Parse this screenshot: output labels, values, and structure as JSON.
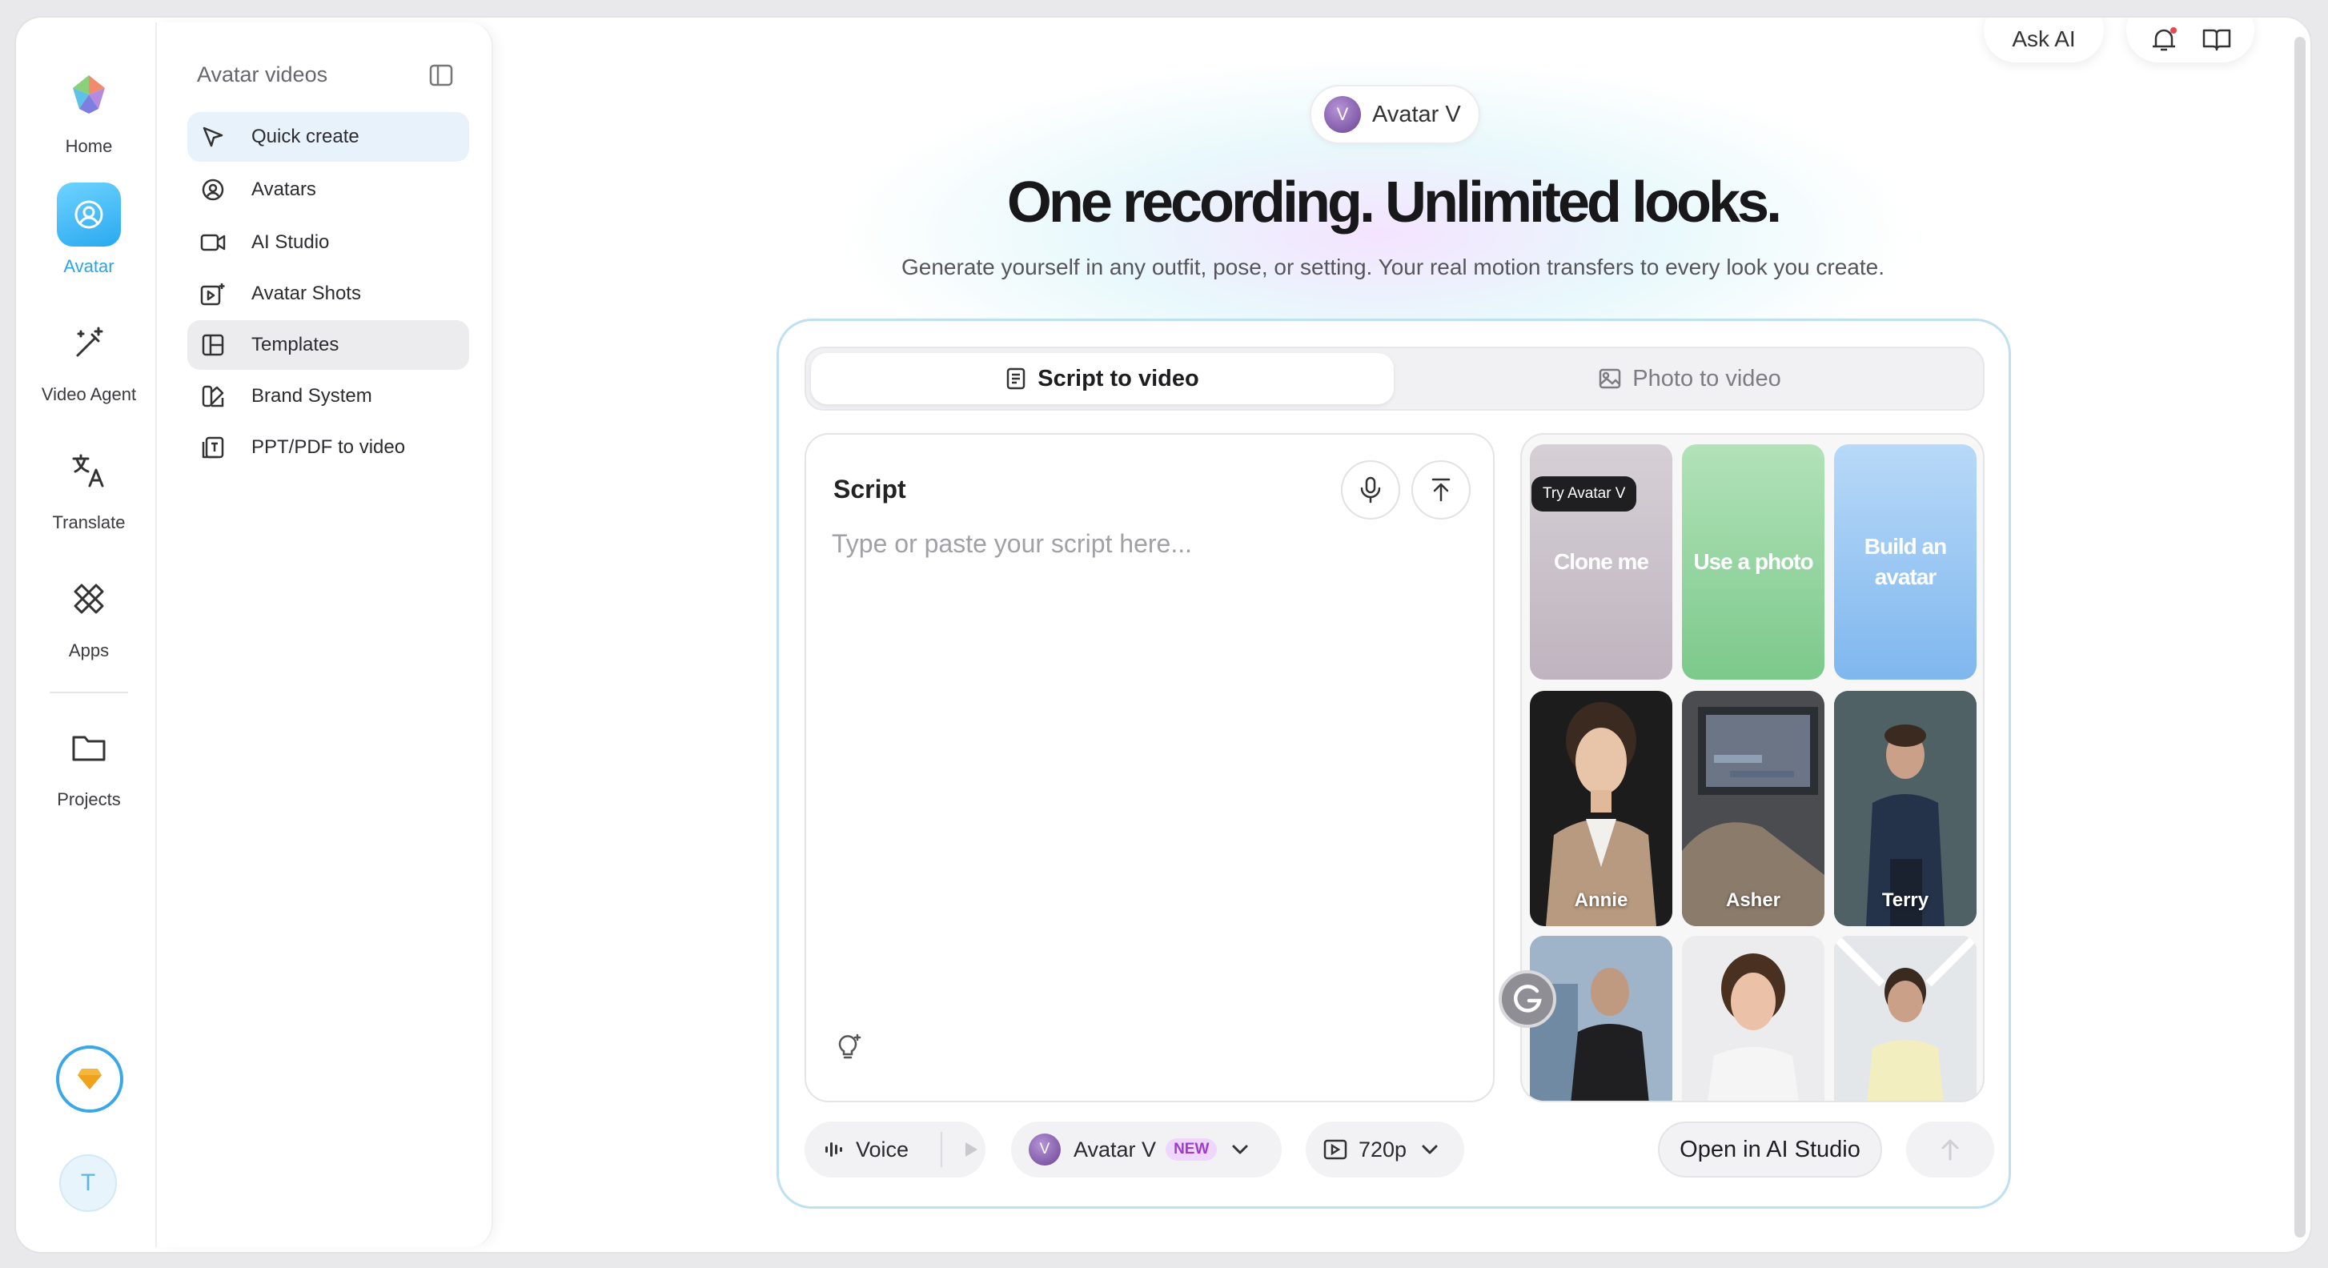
{
  "rail": {
    "items": [
      {
        "label": "Home",
        "icon": "logo-icon"
      },
      {
        "label": "Avatar",
        "icon": "avatar-icon"
      },
      {
        "label": "Video Agent",
        "icon": "magic-wand-icon"
      },
      {
        "label": "Translate",
        "icon": "translate-icon"
      },
      {
        "label": "Apps",
        "icon": "apps-icon"
      },
      {
        "label": "Projects",
        "icon": "folder-icon"
      }
    ],
    "user_initial": "T"
  },
  "sidebar": {
    "title": "Avatar videos",
    "items": [
      {
        "label": "Quick create",
        "icon": "cursor-icon",
        "state": "selected"
      },
      {
        "label": "Avatars",
        "icon": "user-circle-icon"
      },
      {
        "label": "AI Studio",
        "icon": "video-camera-icon"
      },
      {
        "label": "Avatar Shots",
        "icon": "video-sparkle-icon"
      },
      {
        "label": "Templates",
        "icon": "layout-icon",
        "state": "hover"
      },
      {
        "label": "Brand System",
        "icon": "brand-icon"
      },
      {
        "label": "PPT/PDF to video",
        "icon": "document-icon"
      }
    ]
  },
  "top": {
    "ask_ai": "Ask AI"
  },
  "hero": {
    "model_initial": "V",
    "model_name": "Avatar V",
    "headline": "One recording. Unlimited looks.",
    "subline": "Generate yourself in any outfit, pose, or setting. Your real motion transfers to every look you create."
  },
  "tabs": {
    "script_to_video": "Script to video",
    "photo_to_video": "Photo to video"
  },
  "script": {
    "title": "Script",
    "placeholder": "Type or paste your script here..."
  },
  "grid": {
    "badge": "Try Avatar V",
    "actions": [
      {
        "label": "Clone me"
      },
      {
        "label": "Use a photo"
      },
      {
        "label": "Build an avatar"
      }
    ],
    "avatars": [
      {
        "name": "Annie"
      },
      {
        "name": "Asher"
      },
      {
        "name": "Terry"
      },
      {
        "name": ""
      },
      {
        "name": ""
      },
      {
        "name": ""
      }
    ]
  },
  "toolbar": {
    "voice": "Voice",
    "avatar_initial": "V",
    "avatar": "Avatar V",
    "new_badge": "NEW",
    "resolution": "720p",
    "open_studio": "Open in AI Studio"
  },
  "colors": {
    "accent": "#2aa4ea",
    "card_border": "#bfe0f0",
    "new_badge": "#efd6ff"
  }
}
